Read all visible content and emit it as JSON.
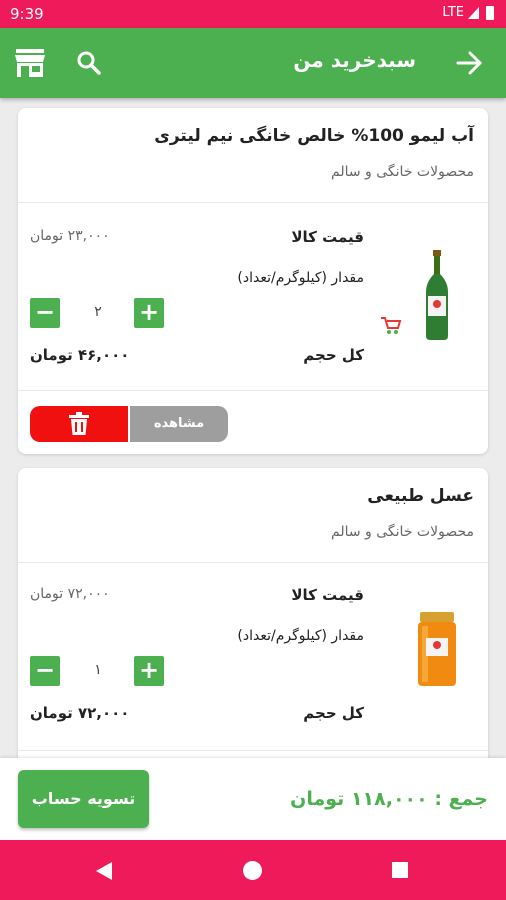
{
  "status_bar": {
    "time": "9:39",
    "network": "LTE"
  },
  "header": {
    "title": "سبدخرید من",
    "icons": [
      "back-arrow-icon",
      "search-icon",
      "store-icon"
    ]
  },
  "items": [
    {
      "name": "آب لیمو 100% خالص خانگی نیم لیتری",
      "category": "محصولات خانگی و سالم",
      "price_label": "قیمت کالا",
      "price_value": "۲۳,۰۰۰ تومان",
      "qty_label": "مقدار (کیلوگرم/تعداد)",
      "quantity": "۲",
      "total_label": "کل حجم",
      "total_value": "۴۶,۰۰۰ تومان",
      "view_label": "مشاهده"
    },
    {
      "name": "عسل طبیعی",
      "category": "محصولات خانگی و سالم",
      "price_label": "قیمت کالا",
      "price_value": "۷۲,۰۰۰ تومان",
      "qty_label": "مقدار (کیلوگرم/تعداد)",
      "quantity": "۱",
      "total_label": "کل حجم",
      "total_value": "۷۲,۰۰۰ تومان"
    }
  ],
  "footer": {
    "checkout_label": "تسویه حساب",
    "sum_text": "جمع : ۱۱۸,۰۰۰ تومان"
  },
  "colors": {
    "primary": "#4caf50",
    "accent": "#ef1a5a",
    "danger": "#f01010",
    "neutral": "#9e9e9e"
  }
}
